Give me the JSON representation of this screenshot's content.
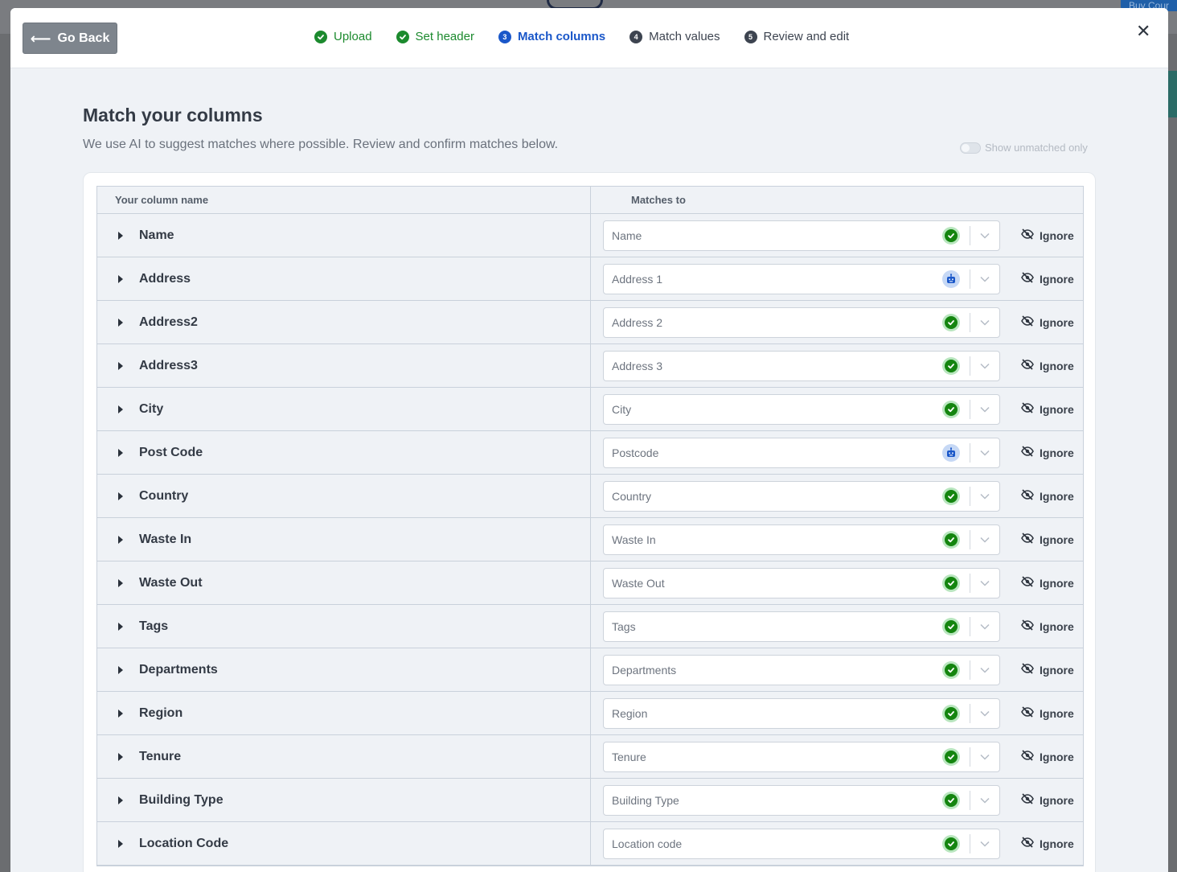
{
  "backdrop": {
    "button_label": "Buy Cour"
  },
  "header": {
    "go_back_label": "Go Back",
    "steps": [
      {
        "label": "Upload",
        "status": "done",
        "number": ""
      },
      {
        "label": "Set header",
        "status": "done",
        "number": ""
      },
      {
        "label": "Match columns",
        "status": "active",
        "number": "3"
      },
      {
        "label": "Match values",
        "status": "pending",
        "number": "4"
      },
      {
        "label": "Review and edit",
        "status": "pending",
        "number": "5"
      }
    ],
    "close_icon": "close-icon"
  },
  "main": {
    "title": "Match your columns",
    "subtitle": "We use AI to suggest matches where possible. Review and confirm matches below.",
    "toggle_label": "Show unmatched only"
  },
  "table": {
    "headers": {
      "your_column": "Your column name",
      "matches_to": "Matches to"
    },
    "ignore_label": "Ignore",
    "rows": [
      {
        "name": "Name",
        "match": "Name",
        "status": "check"
      },
      {
        "name": "Address",
        "match": "Address 1",
        "status": "robot"
      },
      {
        "name": "Address2",
        "match": "Address 2",
        "status": "check"
      },
      {
        "name": "Address3",
        "match": "Address 3",
        "status": "check"
      },
      {
        "name": "City",
        "match": "City",
        "status": "check"
      },
      {
        "name": "Post Code",
        "match": "Postcode",
        "status": "robot"
      },
      {
        "name": "Country",
        "match": "Country",
        "status": "check"
      },
      {
        "name": "Waste In",
        "match": "Waste In",
        "status": "check"
      },
      {
        "name": "Waste Out",
        "match": "Waste Out",
        "status": "check"
      },
      {
        "name": "Tags",
        "match": "Tags",
        "status": "check"
      },
      {
        "name": "Departments",
        "match": "Departments",
        "status": "check"
      },
      {
        "name": "Region",
        "match": "Region",
        "status": "check"
      },
      {
        "name": "Tenure",
        "match": "Tenure",
        "status": "check"
      },
      {
        "name": "Building Type",
        "match": "Building Type",
        "status": "check"
      },
      {
        "name": "Location Code",
        "match": "Location code",
        "status": "check"
      }
    ]
  },
  "colors": {
    "done": "#1c8a2e",
    "active": "#1a57c9",
    "pending": "#3d4450",
    "check": "#14850f",
    "robot": "#1a57c9"
  }
}
